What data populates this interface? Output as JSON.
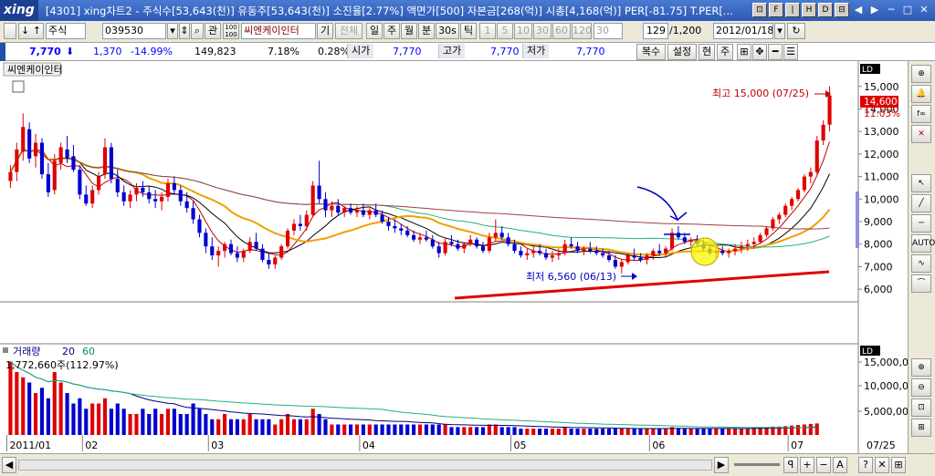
{
  "titlebar": {
    "logo": "xing",
    "title": "[4301] xing차트2 - 주식수[53,643(천)] 유동주[53,643(천)] 소진율[2.77%] 액면가[500] 자본금[268(억)] 시총[4,168(억)] PER[-81.75] T.PER[...",
    "window_buttons": [
      "⊡",
      "F",
      "|",
      "H",
      "D",
      "⊟"
    ],
    "sys_buttons": [
      "◀",
      "▶",
      "─",
      "□",
      "✕"
    ]
  },
  "toolbar": {
    "checkbox_label": "",
    "arrows": "↓ ↑",
    "market_type": "주식",
    "code": "039530",
    "check_label": "관",
    "name_field": "씨엔케이인터",
    "gi_label": "기",
    "all_label": "전체",
    "period_buttons": [
      "일",
      "주",
      "월",
      "분",
      "30s",
      "틱"
    ],
    "minute_buttons": [
      "1",
      "5",
      "10",
      "30",
      "60",
      "120",
      "30"
    ],
    "count": "129",
    "total": "/1,200",
    "date": "2012/01/18"
  },
  "quote": {
    "price": "7,770",
    "change": "1,370",
    "change_pct": "-14.99%",
    "volume": "149,823",
    "pct1": "7.18%",
    "pct2": "0.28%",
    "open_label": "시가",
    "open": "7,770",
    "high_label": "고가",
    "high": "7,770",
    "low_label": "저가",
    "low": "7,770",
    "btn_complex": "복수",
    "btn_setting": "설정",
    "btn_now": "현",
    "btn_week": "주"
  },
  "chart_data": {
    "type": "candlestick",
    "stock_name": "씨엔케이인터",
    "price_axis": [
      "15,000",
      "14,000",
      "13,000",
      "12,000",
      "11,000",
      "10,000",
      "9,000",
      "8,000",
      "7,000",
      "6,000"
    ],
    "volume_axis": [
      "15,000,0",
      "10,000,00",
      "5,000,000"
    ],
    "x_labels": [
      "2011/01",
      "02",
      "03",
      "04",
      "05",
      "06",
      "07",
      "07/25"
    ],
    "high_annotation": "최고 15,000 (07/25)",
    "low_annotation": "최저 6,560 (06/13)",
    "current_price_tag": "14,600",
    "current_pct_tag": "11.03%",
    "volume_legend_label": "거래량",
    "volume_legend_ma1": "20",
    "volume_legend_ma2": "60",
    "volume_max_label": "1,772,660주(112.97%)",
    "y_range": [
      5600,
      15800
    ],
    "volume_range": [
      0,
      16000000
    ],
    "candles": [
      [
        10800,
        11500,
        10500,
        11200
      ],
      [
        11200,
        12500,
        10800,
        12200
      ],
      [
        12100,
        13800,
        11700,
        13200
      ],
      [
        13100,
        13400,
        11600,
        11800
      ],
      [
        11900,
        12900,
        11400,
        12500
      ],
      [
        12500,
        12700,
        10900,
        11100
      ],
      [
        11100,
        11600,
        10100,
        10300
      ],
      [
        10400,
        12000,
        10200,
        11700
      ],
      [
        11600,
        12500,
        11300,
        12300
      ],
      [
        12200,
        12800,
        11600,
        11800
      ],
      [
        11900,
        12400,
        11200,
        11300
      ],
      [
        11300,
        11500,
        10000,
        10200
      ],
      [
        10200,
        10600,
        9700,
        9800
      ],
      [
        9800,
        10600,
        9600,
        10400
      ],
      [
        10400,
        11200,
        10200,
        11000
      ],
      [
        11100,
        12700,
        10900,
        12300
      ],
      [
        12300,
        12500,
        10700,
        10900
      ],
      [
        10900,
        11300,
        10100,
        10300
      ],
      [
        10300,
        10600,
        9700,
        9900
      ],
      [
        9900,
        10400,
        9600,
        10200
      ],
      [
        10200,
        10700,
        9900,
        10500
      ],
      [
        10500,
        10800,
        10100,
        10300
      ],
      [
        10300,
        10600,
        9800,
        10000
      ],
      [
        10000,
        10400,
        9600,
        9900
      ],
      [
        9900,
        10300,
        9500,
        10100
      ],
      [
        10100,
        10900,
        9900,
        10700
      ],
      [
        10700,
        11000,
        10200,
        10400
      ],
      [
        10400,
        10600,
        9700,
        9900
      ],
      [
        9900,
        10300,
        9400,
        9600
      ],
      [
        9600,
        9900,
        8900,
        9100
      ],
      [
        9100,
        9300,
        8300,
        8500
      ],
      [
        8500,
        8700,
        7600,
        7900
      ],
      [
        7900,
        8300,
        7300,
        7500
      ],
      [
        7500,
        7900,
        7000,
        7700
      ],
      [
        7700,
        8100,
        7400,
        8000
      ],
      [
        8000,
        8200,
        7500,
        7600
      ],
      [
        7600,
        7900,
        7200,
        7400
      ],
      [
        7400,
        7800,
        7200,
        7700
      ],
      [
        7700,
        8300,
        7600,
        8100
      ],
      [
        8100,
        8500,
        7700,
        7800
      ],
      [
        7800,
        8000,
        7200,
        7300
      ],
      [
        7300,
        7600,
        6900,
        7100
      ],
      [
        7100,
        7500,
        6900,
        7400
      ],
      [
        7400,
        8000,
        7300,
        7900
      ],
      [
        7900,
        8700,
        7800,
        8600
      ],
      [
        8600,
        9100,
        8400,
        8900
      ],
      [
        8900,
        9300,
        8600,
        8800
      ],
      [
        8800,
        9500,
        8600,
        9300
      ],
      [
        9300,
        10800,
        9200,
        10600
      ],
      [
        10600,
        11700,
        9800,
        10000
      ],
      [
        10000,
        10300,
        9200,
        9500
      ],
      [
        9500,
        9900,
        9200,
        9700
      ],
      [
        9700,
        10000,
        9300,
        9400
      ],
      [
        9400,
        9700,
        9200,
        9600
      ],
      [
        9600,
        9800,
        9300,
        9400
      ],
      [
        9400,
        9700,
        9200,
        9500
      ],
      [
        9500,
        9800,
        9200,
        9300
      ],
      [
        9300,
        9600,
        9100,
        9500
      ],
      [
        9500,
        9800,
        9200,
        9300
      ],
      [
        9300,
        9500,
        8900,
        9000
      ],
      [
        9000,
        9200,
        8600,
        8800
      ],
      [
        8800,
        9100,
        8500,
        8700
      ],
      [
        8700,
        8900,
        8400,
        8600
      ],
      [
        8600,
        8800,
        8300,
        8400
      ],
      [
        8400,
        8600,
        8100,
        8200
      ],
      [
        8200,
        8500,
        8000,
        8300
      ],
      [
        8300,
        8600,
        8100,
        8200
      ],
      [
        8200,
        8400,
        7800,
        7900
      ],
      [
        7900,
        8100,
        7400,
        7600
      ],
      [
        7600,
        8300,
        7500,
        8100
      ],
      [
        8100,
        8400,
        7900,
        8000
      ],
      [
        8000,
        8200,
        7700,
        7800
      ],
      [
        7800,
        8100,
        7600,
        8000
      ],
      [
        8000,
        8400,
        7900,
        8200
      ],
      [
        8200,
        8300,
        7800,
        7900
      ],
      [
        7900,
        8100,
        7600,
        7700
      ],
      [
        7700,
        8500,
        7600,
        8300
      ],
      [
        8300,
        9100,
        8100,
        8500
      ],
      [
        8500,
        8800,
        8200,
        8300
      ],
      [
        8300,
        8500,
        7900,
        8000
      ],
      [
        8000,
        8200,
        7600,
        7700
      ],
      [
        7700,
        7900,
        7400,
        7500
      ],
      [
        7500,
        7800,
        7300,
        7600
      ],
      [
        7600,
        7900,
        7400,
        7700
      ],
      [
        7700,
        8000,
        7500,
        7600
      ],
      [
        7600,
        7800,
        7300,
        7400
      ],
      [
        7400,
        7700,
        7200,
        7500
      ],
      [
        7500,
        7800,
        7300,
        7600
      ],
      [
        7600,
        8200,
        7500,
        8000
      ],
      [
        8000,
        8300,
        7800,
        7900
      ],
      [
        7900,
        8100,
        7600,
        7700
      ],
      [
        7700,
        7900,
        7500,
        7800
      ],
      [
        7800,
        8100,
        7600,
        7700
      ],
      [
        7700,
        7900,
        7500,
        7600
      ],
      [
        7600,
        7800,
        7400,
        7500
      ],
      [
        7500,
        7700,
        7200,
        7300
      ],
      [
        7300,
        7500,
        6900,
        7000
      ],
      [
        7000,
        7300,
        6700,
        7200
      ],
      [
        7200,
        7600,
        7100,
        7500
      ],
      [
        7500,
        7800,
        7300,
        7400
      ],
      [
        7400,
        7600,
        7200,
        7300
      ],
      [
        7300,
        7600,
        7100,
        7500
      ],
      [
        7500,
        7800,
        7300,
        7700
      ],
      [
        7700,
        8000,
        7500,
        7600
      ],
      [
        7600,
        7900,
        7400,
        7800
      ],
      [
        7800,
        8700,
        7700,
        8500
      ],
      [
        8500,
        8800,
        8200,
        8300
      ],
      [
        8300,
        8500,
        8000,
        8100
      ],
      [
        8100,
        8300,
        7900,
        8200
      ],
      [
        8200,
        8400,
        7900,
        8000
      ],
      [
        8000,
        8200,
        7700,
        7800
      ],
      [
        7800,
        8000,
        7500,
        7600
      ],
      [
        7600,
        7900,
        7400,
        7700
      ],
      [
        7700,
        7900,
        7500,
        7600
      ],
      [
        7600,
        7800,
        7400,
        7700
      ],
      [
        7700,
        8000,
        7500,
        7800
      ],
      [
        7800,
        8100,
        7600,
        7900
      ],
      [
        7900,
        8200,
        7700,
        8000
      ],
      [
        8000,
        8300,
        7800,
        8100
      ],
      [
        8100,
        8500,
        8000,
        8400
      ],
      [
        8400,
        8800,
        8300,
        8700
      ],
      [
        8700,
        9200,
        8600,
        9100
      ],
      [
        9100,
        9400,
        8900,
        9300
      ],
      [
        9300,
        9800,
        9200,
        9700
      ],
      [
        9700,
        10100,
        9500,
        10000
      ],
      [
        10000,
        10500,
        9900,
        10400
      ],
      [
        10400,
        11100,
        10300,
        11000
      ],
      [
        11000,
        11400,
        10700,
        11200
      ],
      [
        11200,
        12800,
        11100,
        12600
      ],
      [
        12600,
        13500,
        12400,
        13300
      ],
      [
        13300,
        15000,
        13000,
        14600
      ]
    ],
    "volumes": [
      14,
      12,
      11,
      10,
      8,
      9,
      7,
      12,
      10,
      8,
      6,
      7,
      5,
      6,
      6,
      7,
      5,
      6,
      5,
      4,
      4,
      5,
      4,
      5,
      4,
      5,
      5,
      4,
      4,
      6,
      5,
      4,
      3,
      3,
      4,
      3,
      3,
      3,
      4,
      3,
      3,
      3,
      2,
      3,
      4,
      3,
      3,
      3,
      5,
      4,
      3,
      2,
      2,
      2,
      2,
      2,
      2,
      2,
      2,
      2,
      2,
      2,
      2,
      2,
      2,
      2,
      2,
      2,
      2,
      2,
      1.5,
      1.5,
      1.5,
      1.5,
      1.5,
      1.5,
      2,
      2,
      1.5,
      1.5,
      1.5,
      1.2,
      1.2,
      1.2,
      1.2,
      1.2,
      1.2,
      1.2,
      1.5,
      1.2,
      1.2,
      1.2,
      1.2,
      1.2,
      1.2,
      1.2,
      1.3,
      1.3,
      1.2,
      1.2,
      1.2,
      1.2,
      1.2,
      1.2,
      1.2,
      1.5,
      1.3,
      1.2,
      1.2,
      1.2,
      1.2,
      1.2,
      1.2,
      1.2,
      1.2,
      1.2,
      1.2,
      1.3,
      1.4,
      1.5,
      1.5,
      1.6,
      1.6,
      1.7,
      1.8,
      1.9,
      2.0,
      2.1,
      2.2
    ]
  },
  "right_panel": {
    "icons": [
      "crosshair-icon",
      "bell-icon",
      "cursor-icon",
      "trendline-icon",
      "rsline-icon",
      "auto-icon",
      "wave-icon",
      "curve-icon"
    ]
  },
  "bottom": {
    "zoom_label": "ꟼ",
    "buttons": [
      "+",
      "−",
      "A",
      "?",
      "✕",
      "⊞"
    ]
  }
}
